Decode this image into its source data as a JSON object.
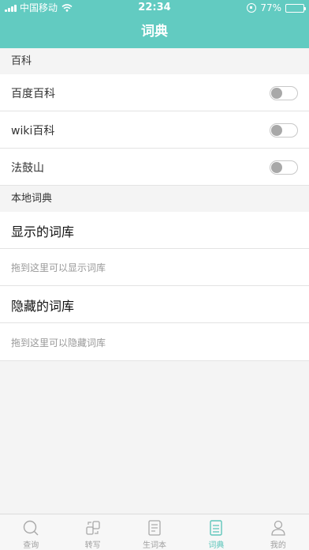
{
  "status_bar": {
    "carrier": "中国移动",
    "time": "22:34",
    "battery": "77%",
    "battery_level": 0.77
  },
  "header": {
    "title": "词典"
  },
  "encyclopedia": {
    "section_label": "百科",
    "items": [
      {
        "label": "百度百科",
        "enabled": false
      },
      {
        "label": "wiki百科",
        "enabled": false
      },
      {
        "label": "法鼓山",
        "enabled": false
      }
    ]
  },
  "local_dict": {
    "section_label": "本地词典",
    "shown": {
      "title": "显示的词库",
      "hint": "拖到这里可以显示词库"
    },
    "hidden": {
      "title": "隐藏的词库",
      "hint": "拖到这里可以隐藏词库"
    }
  },
  "tabbar": {
    "accent": "#5ec6bb",
    "tabs": [
      {
        "label": "查询",
        "icon": "search-icon",
        "active": false
      },
      {
        "label": "转写",
        "icon": "transcribe-icon",
        "active": false
      },
      {
        "label": "生词本",
        "icon": "notebook-icon",
        "active": false
      },
      {
        "label": "词典",
        "icon": "dictionary-icon",
        "active": true
      },
      {
        "label": "我的",
        "icon": "profile-icon",
        "active": false
      }
    ]
  },
  "colors": {
    "header_bg": "#62cbc1",
    "page_bg": "#f4f4f4"
  }
}
